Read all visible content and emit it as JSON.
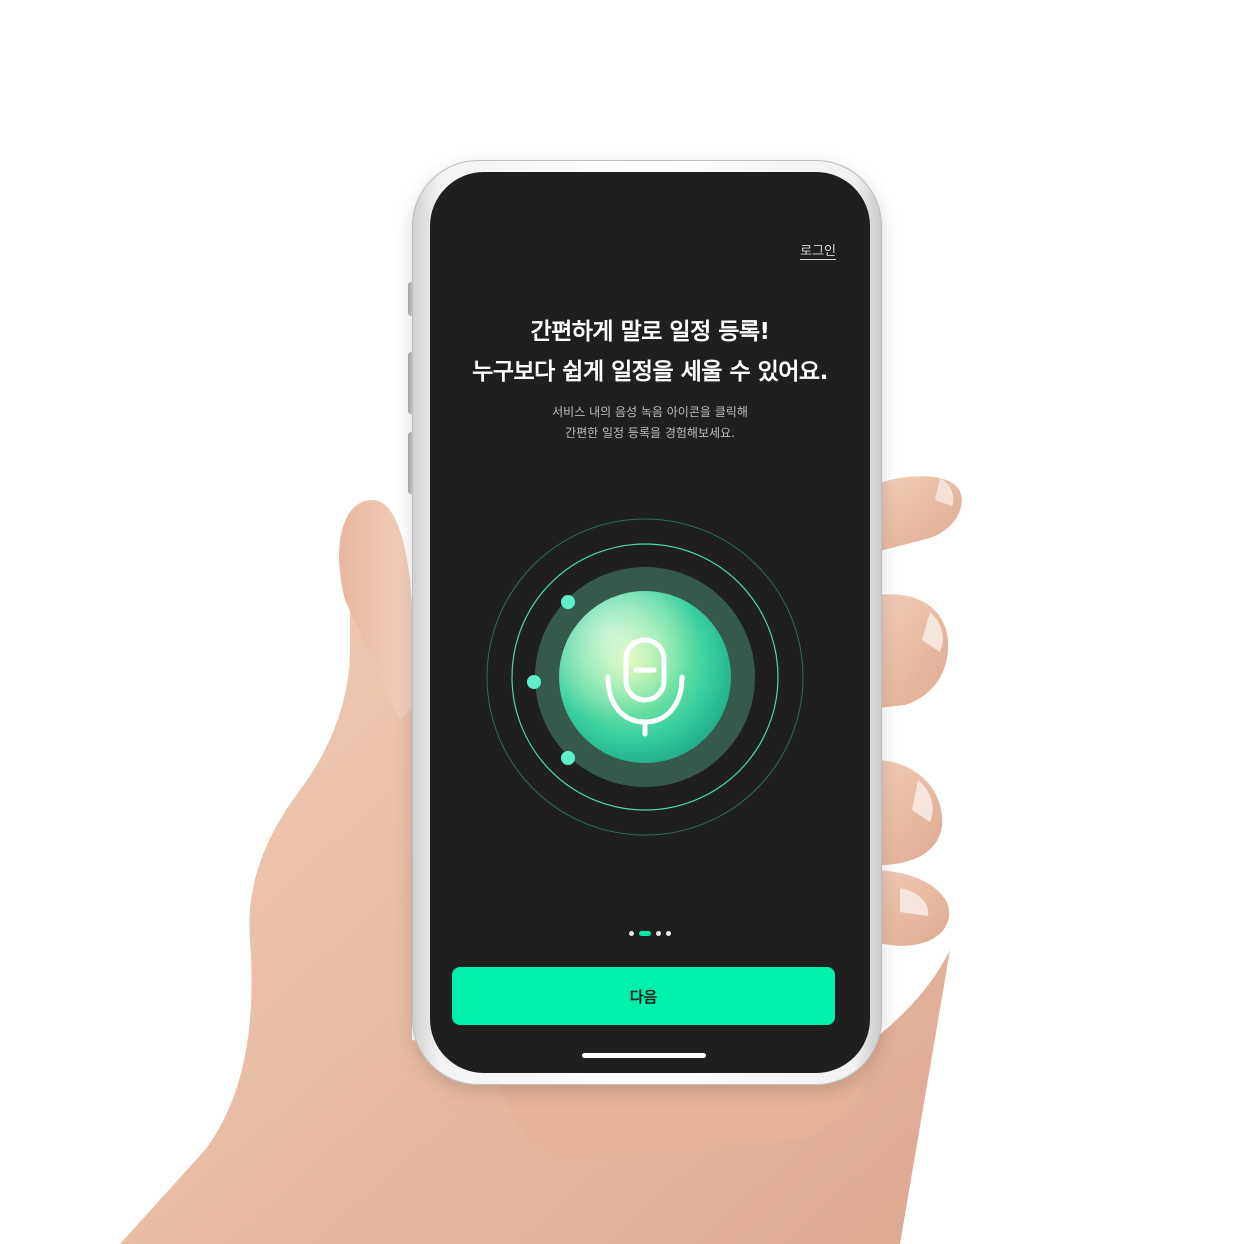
{
  "header": {
    "login_label": "로그인"
  },
  "onboarding": {
    "headline_line1": "간편하게 말로 일정 등록!",
    "headline_line2": "누구보다 쉽게 일정을 세울 수 있어요.",
    "subtext_line1": "서비스 내의 음성 녹음 아이콘을 클릭해",
    "subtext_line2": "간편한 일정 등록을 경험해보세요."
  },
  "mic": {
    "icon": "microphone-icon"
  },
  "pager": {
    "total": 4,
    "current": 2
  },
  "footer": {
    "next_label": "다음"
  },
  "colors": {
    "screen_bg": "#1f1f1f",
    "accent": "#00f0ae",
    "ring_fill": "#355a4c",
    "ring_line": "#4fd6b1"
  }
}
